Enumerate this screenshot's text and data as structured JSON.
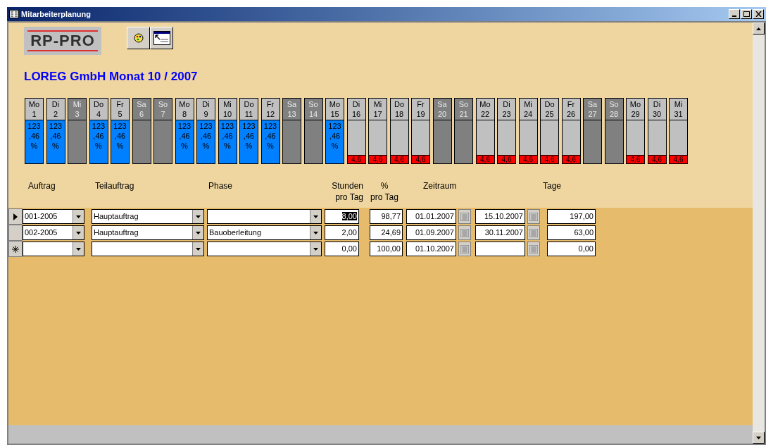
{
  "window": {
    "title": "Mitarbeiterplanung"
  },
  "logo": "RP-PRO",
  "heading": "LOREG GmbH Monat 10 / 2007",
  "days": [
    {
      "weekday": "Mo",
      "day": "1",
      "kind": "booked",
      "load_lines": [
        "123",
        ",46",
        "%"
      ]
    },
    {
      "weekday": "Di",
      "day": "2",
      "kind": "booked",
      "load_lines": [
        "123",
        ",46",
        "%"
      ]
    },
    {
      "weekday": "Mi",
      "day": "3",
      "kind": "off"
    },
    {
      "weekday": "Do",
      "day": "4",
      "kind": "booked",
      "load_lines": [
        "123",
        ",46",
        "%"
      ]
    },
    {
      "weekday": "Fr",
      "day": "5",
      "kind": "booked",
      "load_lines": [
        "123",
        ",46",
        "%"
      ]
    },
    {
      "weekday": "Sa",
      "day": "6",
      "kind": "off"
    },
    {
      "weekday": "So",
      "day": "7",
      "kind": "off"
    },
    {
      "weekday": "Mo",
      "day": "8",
      "kind": "booked",
      "load_lines": [
        "123",
        ",46",
        "%"
      ]
    },
    {
      "weekday": "Di",
      "day": "9",
      "kind": "booked",
      "load_lines": [
        "123",
        ",46",
        "%"
      ]
    },
    {
      "weekday": "Mi",
      "day": "10",
      "kind": "booked",
      "load_lines": [
        "123",
        ",46",
        "%"
      ]
    },
    {
      "weekday": "Do",
      "day": "11",
      "kind": "booked",
      "load_lines": [
        "123",
        ",46",
        "%"
      ]
    },
    {
      "weekday": "Fr",
      "day": "12",
      "kind": "booked",
      "load_lines": [
        "123",
        ",46",
        "%"
      ]
    },
    {
      "weekday": "Sa",
      "day": "13",
      "kind": "off"
    },
    {
      "weekday": "So",
      "day": "14",
      "kind": "off"
    },
    {
      "weekday": "Mo",
      "day": "15",
      "kind": "booked",
      "load_lines": [
        "123",
        ",46",
        "%"
      ]
    },
    {
      "weekday": "Di",
      "day": "16",
      "kind": "open",
      "load": "4,6"
    },
    {
      "weekday": "Mi",
      "day": "17",
      "kind": "open",
      "load": "4,6"
    },
    {
      "weekday": "Do",
      "day": "18",
      "kind": "open",
      "load": "4,6"
    },
    {
      "weekday": "Fr",
      "day": "19",
      "kind": "open",
      "load": "4,6"
    },
    {
      "weekday": "Sa",
      "day": "20",
      "kind": "off"
    },
    {
      "weekday": "So",
      "day": "21",
      "kind": "off"
    },
    {
      "weekday": "Mo",
      "day": "22",
      "kind": "open",
      "load": "4,6"
    },
    {
      "weekday": "Di",
      "day": "23",
      "kind": "open",
      "load": "4,6"
    },
    {
      "weekday": "Mi",
      "day": "24",
      "kind": "open",
      "load": "4,6"
    },
    {
      "weekday": "Do",
      "day": "25",
      "kind": "open",
      "load": "4,6"
    },
    {
      "weekday": "Fr",
      "day": "26",
      "kind": "open",
      "load": "4,6"
    },
    {
      "weekday": "Sa",
      "day": "27",
      "kind": "off"
    },
    {
      "weekday": "So",
      "day": "28",
      "kind": "off"
    },
    {
      "weekday": "Mo",
      "day": "29",
      "kind": "open",
      "load": "4,6"
    },
    {
      "weekday": "Di",
      "day": "30",
      "kind": "open",
      "load": "4,6"
    },
    {
      "weekday": "Mi",
      "day": "31",
      "kind": "open",
      "load": "4,6"
    }
  ],
  "columns": {
    "auftrag": "Auftrag",
    "teilauftrag": "Teilauftrag",
    "phase": "Phase",
    "stunden": [
      "Stunden",
      "pro Tag"
    ],
    "prozent": [
      "%",
      "pro Tag"
    ],
    "zeitraum": "Zeitraum",
    "tage": "Tage"
  },
  "rows": [
    {
      "kind": "current",
      "auftrag": "001-2005",
      "teilauftrag": "Hauptauftrag",
      "stunden": "8,00",
      "stunden_focused": true,
      "prozent": "98,77",
      "von": "01.01.2007",
      "bis": "15.10.2007",
      "tage": "197,00"
    },
    {
      "kind": "existing",
      "auftrag": "002-2005",
      "teilauftrag": "Hauptauftrag",
      "phase": "Bauoberleitung",
      "stunden": "2,00",
      "stunden_focused": false,
      "prozent": "24,69",
      "von": "01.09.2007",
      "bis": "30.11.2007",
      "tage": "63,00"
    },
    {
      "kind": "new",
      "stunden": "0,00",
      "stunden_focused": false,
      "prozent": "100,00",
      "von": "01.10.2007",
      "tage": "0,00"
    }
  ]
}
